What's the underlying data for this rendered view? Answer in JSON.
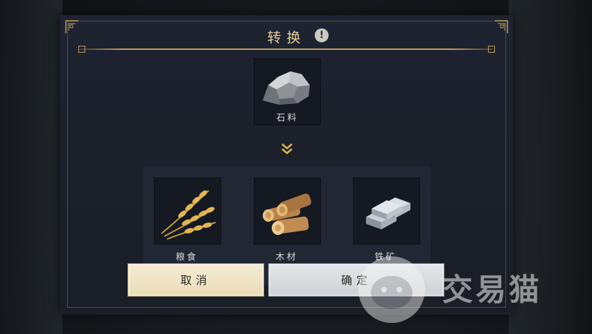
{
  "dialog": {
    "title": "转换",
    "info_glyph": "!",
    "source": {
      "label": "石料",
      "icon": "stone-icon"
    },
    "arrow_icon": "double-chevron-down-icon",
    "targets": [
      {
        "label": "粮食",
        "icon": "wheat-icon"
      },
      {
        "label": "木材",
        "icon": "logs-icon"
      },
      {
        "label": "铁矿",
        "icon": "iron-ingot-icon"
      }
    ],
    "buttons": {
      "cancel": "取消",
      "confirm": "确定"
    }
  },
  "watermark": {
    "text": "交易猫",
    "icon": "cat-logo-icon"
  },
  "colors": {
    "gold_accent": "#c4a05c",
    "title": "#e7cf9a",
    "dialog_bg": "#1d2330",
    "cancel_bg": "#f6ecd2",
    "confirm_bg": "#e4e6e8"
  }
}
